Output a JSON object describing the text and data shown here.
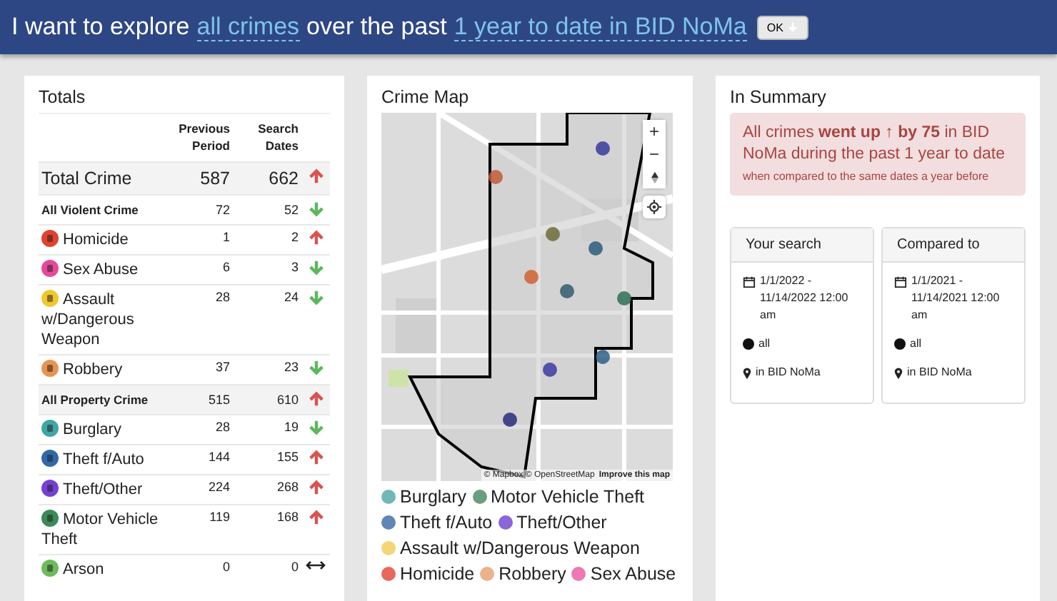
{
  "header": {
    "lead": "I want to explore",
    "crime_link": "all crimes",
    "middle": "over the past",
    "period_link": "1 year to date in BID NoMa",
    "button": "OK"
  },
  "totals": {
    "title": "Totals",
    "columns": [
      "Previous Period",
      "Search Dates"
    ],
    "rows": [
      {
        "kind": "total",
        "label": "Total Crime",
        "previous": "587",
        "search": "662",
        "increased": true,
        "decreased": false
      },
      {
        "kind": "group",
        "label": "All Violent Crime",
        "previous": "72",
        "search": "52",
        "increased": false,
        "decreased": true
      },
      {
        "kind": "item",
        "label": "Homicide",
        "previous": "1",
        "search": "2",
        "increased": true,
        "decreased": false,
        "color": "#e2412f"
      },
      {
        "kind": "item",
        "label": "Sex Abuse",
        "previous": "6",
        "search": "3",
        "increased": false,
        "decreased": true,
        "color": "#e8489a"
      },
      {
        "kind": "item",
        "label": "Assault w/Dangerous Weapon",
        "previous": "28",
        "search": "24",
        "increased": false,
        "decreased": true,
        "color": "#f2c72e"
      },
      {
        "kind": "item",
        "label": "Robbery",
        "previous": "37",
        "search": "23",
        "increased": false,
        "decreased": true,
        "color": "#e9934f"
      },
      {
        "kind": "group",
        "label": "All Property Crime",
        "previous": "515",
        "search": "610",
        "increased": true,
        "decreased": false
      },
      {
        "kind": "item",
        "label": "Burglary",
        "previous": "28",
        "search": "19",
        "increased": false,
        "decreased": true,
        "color": "#3fa5a5"
      },
      {
        "kind": "item",
        "label": "Theft f/Auto",
        "previous": "144",
        "search": "155",
        "increased": true,
        "decreased": false,
        "color": "#2f69a8"
      },
      {
        "kind": "item",
        "label": "Theft/Other",
        "previous": "224",
        "search": "268",
        "increased": true,
        "decreased": false,
        "color": "#7440d6"
      },
      {
        "kind": "item",
        "label": "Motor Vehicle Theft",
        "previous": "119",
        "search": "168",
        "increased": true,
        "decreased": false,
        "color": "#3b8a57"
      },
      {
        "kind": "item",
        "label": "Arson",
        "previous": "0",
        "search": "0",
        "increased": false,
        "decreased": false,
        "color": "#6dbb5a"
      }
    ]
  },
  "map": {
    "title": "Crime Map",
    "attribution": "© Mapbox © OpenStreetMap",
    "improve_link": "Improve this map",
    "zoom_in": "+",
    "zoom_out": "−",
    "legend": [
      {
        "label": "Burglary",
        "color": "#6fb8b5"
      },
      {
        "label": "Motor Vehicle Theft",
        "color": "#6a9e7c"
      },
      {
        "label": "Theft f/Auto",
        "color": "#5f86b5"
      },
      {
        "label": "Theft/Other",
        "color": "#8a66d8"
      },
      {
        "label": "Assault w/Dangerous Weapon",
        "color": "#f3d676"
      },
      {
        "label": "Homicide",
        "color": "#e8685e"
      },
      {
        "label": "Robbery",
        "color": "#ebb38c"
      },
      {
        "label": "Sex Abuse",
        "color": "#ee79b4"
      }
    ]
  },
  "summary": {
    "title": "In Summary",
    "headline": "All crimes **went up ↑ by 75** in BID NoMa during the past 1 year to date",
    "note": "when compared to the same dates a year before",
    "panels": [
      {
        "title": "Your search",
        "dates": "1/1/2022 - 11/14/2022 12:00 am",
        "crimes": "all",
        "place": "in BID NoMa"
      },
      {
        "title": "Compared to",
        "dates": "1/1/2021 - 11/14/2021 12:00 am",
        "crimes": "all",
        "place": "in BID NoMa"
      }
    ]
  }
}
